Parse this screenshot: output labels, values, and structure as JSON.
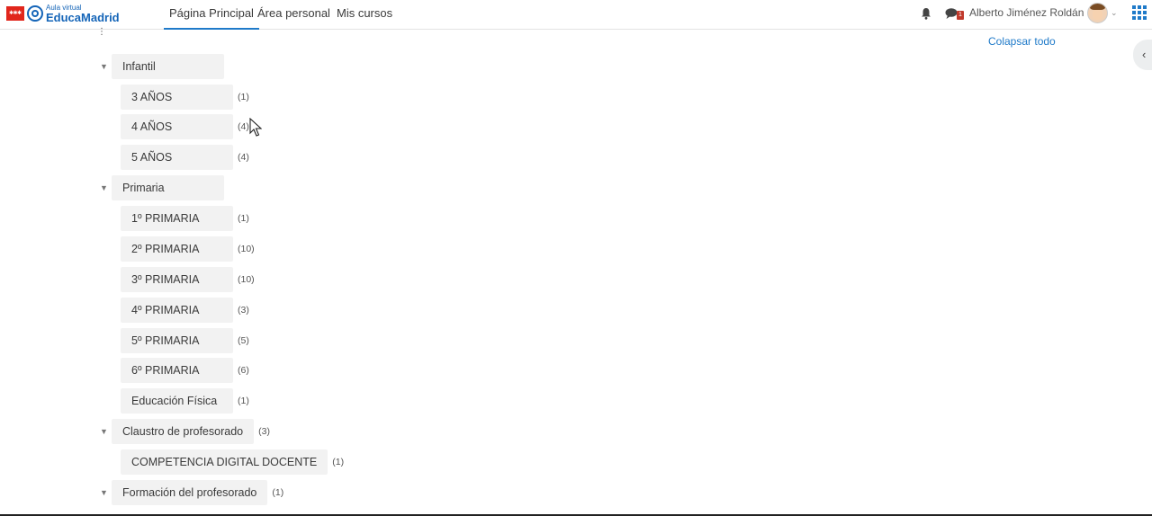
{
  "navbar": {
    "logo_sub": "Aula virtual",
    "logo_main": "EducaMadrid",
    "links": [
      "Página Principal",
      "Área personal",
      "Mis cursos"
    ],
    "active_link": "Página Principal",
    "message_badge": "1",
    "user_name": "Alberto Jiménez Roldán"
  },
  "page": {
    "collapse_all": "Colapsar todo"
  },
  "categories": [
    {
      "label": "Infantil",
      "level": 0,
      "count": ""
    },
    {
      "label": "3 AÑOS",
      "level": 1,
      "count": "(1)"
    },
    {
      "label": "4 AÑOS",
      "level": 1,
      "count": "(4)"
    },
    {
      "label": "5 AÑOS",
      "level": 1,
      "count": "(4)"
    },
    {
      "label": "Primaria",
      "level": 0,
      "count": ""
    },
    {
      "label": "1º PRIMARIA",
      "level": 1,
      "count": "(1)"
    },
    {
      "label": "2º PRIMARIA",
      "level": 1,
      "count": "(10)"
    },
    {
      "label": "3º PRIMARIA",
      "level": 1,
      "count": "(10)"
    },
    {
      "label": "4º PRIMARIA",
      "level": 1,
      "count": "(3)"
    },
    {
      "label": "5º PRIMARIA",
      "level": 1,
      "count": "(5)"
    },
    {
      "label": "6º PRIMARIA",
      "level": 1,
      "count": "(6)"
    },
    {
      "label": "Educación Física",
      "level": 1,
      "count": "(1)"
    },
    {
      "label": "Claustro de profesorado",
      "level": 0,
      "count": "(3)"
    },
    {
      "label": "COMPETENCIA DIGITAL DOCENTE",
      "level": 1,
      "count": "(1)"
    },
    {
      "label": "Formación del profesorado",
      "level": 0,
      "count": "(1)"
    }
  ],
  "colors": {
    "accent": "#1f7ac9",
    "logo_red": "#e1261c",
    "logo_blue": "#1565b8",
    "pill_bg": "#f2f2f2"
  }
}
